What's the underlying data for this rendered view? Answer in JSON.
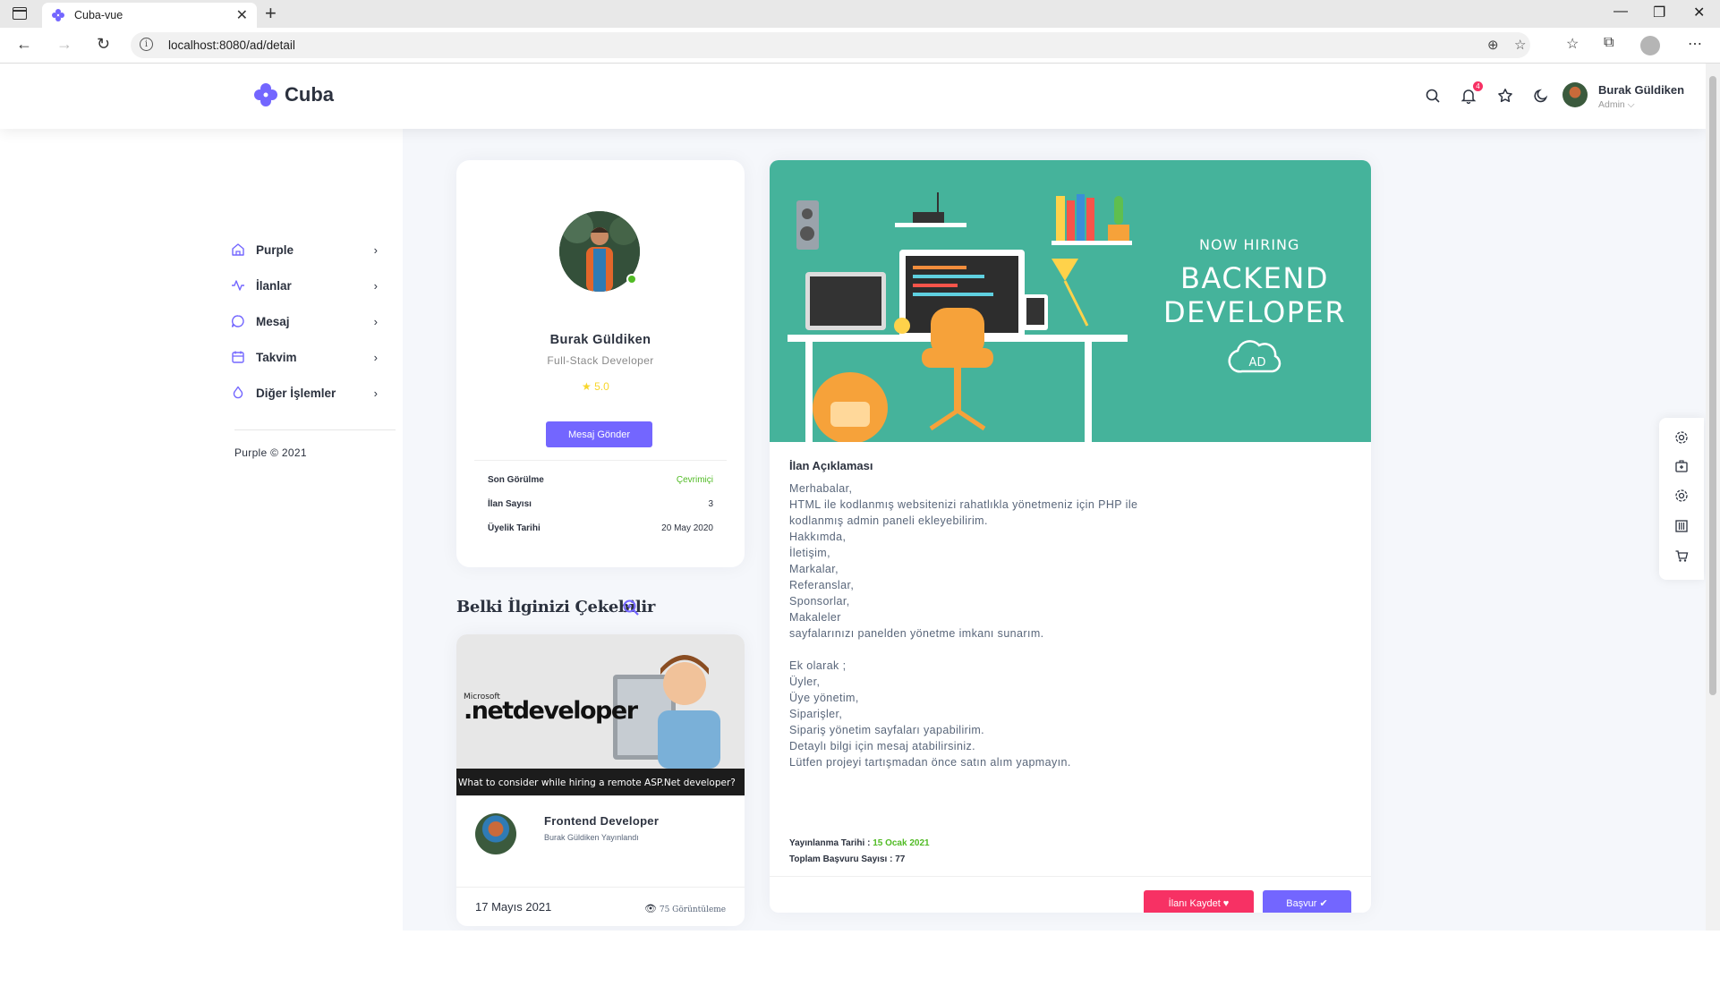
{
  "browser": {
    "tab_title": "Cuba-vue",
    "tab_close": "✕",
    "new_tab": "+",
    "url": "localhost:8080/ad/detail",
    "omni_info": "i"
  },
  "header": {
    "logo": "Cuba",
    "notification_count": "4",
    "user_name": "Burak Güldiken",
    "user_role": "Admin ⌵"
  },
  "sidebar": {
    "items": [
      {
        "label": "Purple",
        "icon": "home-icon"
      },
      {
        "label": "İlanlar",
        "icon": "activity-icon"
      },
      {
        "label": "Mesaj",
        "icon": "message-icon"
      },
      {
        "label": "Takvim",
        "icon": "calendar-icon"
      },
      {
        "label": "Diğer İşlemler",
        "icon": "droplet-icon"
      }
    ],
    "chevron": "›",
    "footer": "Purple © 2021"
  },
  "profile": {
    "name": "Burak Güldiken",
    "title": "Full-Stack Developer",
    "rating": "5.0",
    "message_button": "Mesaj Gönder",
    "rows": [
      {
        "key": "Son Görülme",
        "value": "Çevrimiçi",
        "color": "#51bb25"
      },
      {
        "key": "İlan Sayısı",
        "value": "3"
      },
      {
        "key": "Üyelik Tarihi",
        "value": "20 May 2020"
      }
    ]
  },
  "suggest": {
    "title": "Belki İlginizi Çekebilir",
    "card": {
      "image_caption": "What to consider while hiring a remote ASP.Net developer?",
      "image_brand_small": "Microsoft",
      "image_brand": ".netdeveloper",
      "title": "Frontend Developer",
      "subtitle": "Burak Güldiken Yayınlandı",
      "date": "17 Mayıs 2021",
      "views": "75 Görüntüleme"
    }
  },
  "ad": {
    "hero_now": "NOW HIRING",
    "hero_role_1": "BACKEND",
    "hero_role_2": "DEVELOPER",
    "hero_logo": "AD",
    "description_title": "İlan Açıklaması",
    "description_lines": [
      "Merhabalar,",
      "HTML ile kodlanmış websitenizi rahatlıkla yönetmeniz için PHP ile",
      "kodlanmış admin paneli ekleyebilirim.",
      "Hakkımda,",
      "İletişim,",
      "Markalar,",
      "Referanslar,",
      "Sponsorlar,",
      "Makaleler",
      "sayfalarınızı panelden yönetme imkanı sunarım.",
      "",
      "Ek olarak ;",
      "Üyler,",
      "Üye yönetim,",
      "Siparişler,",
      "Sipariş yönetim sayfaları yapabilirim.",
      "Detaylı bilgi için mesaj atabilirsiniz.",
      "Lütfen projeyi tartışmadan önce satın alım yapmayın."
    ],
    "published_label": "Yayınlanma Tarihi :",
    "published_value": "15 Ocak 2021",
    "applications_label": "Toplam Başvuru Sayısı :",
    "applications_value": "77",
    "save_button": "İlanı Kaydet ♥",
    "apply_button": "Başvur ✔"
  },
  "colors": {
    "primary": "#7366ff",
    "secondary": "#f73164",
    "success": "#51bb25",
    "hero_bg": "#45b39b"
  }
}
